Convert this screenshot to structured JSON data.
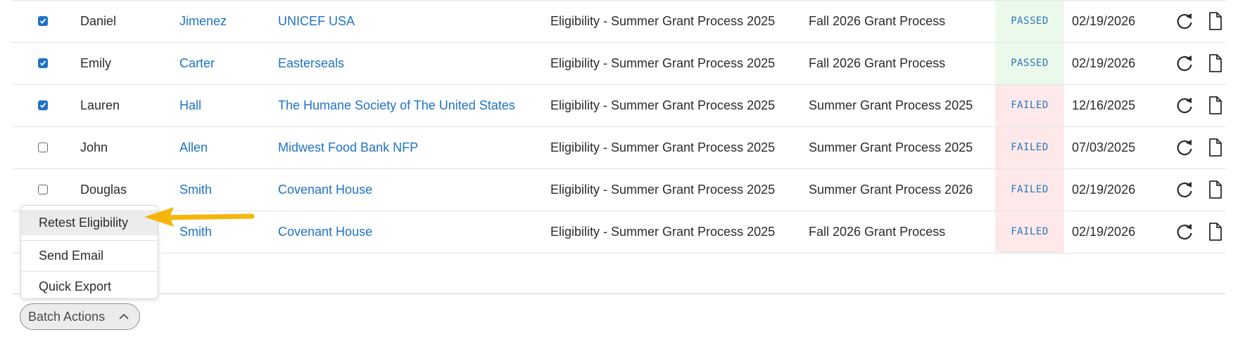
{
  "rows": [
    {
      "checked": true,
      "first": "Daniel",
      "last": "Jimenez",
      "org": "UNICEF USA",
      "eligibility": "Eligibility - Summer Grant Process 2025",
      "process": "Fall 2026 Grant Process",
      "status": "PASSED",
      "date": "02/19/2026"
    },
    {
      "checked": true,
      "first": "Emily",
      "last": "Carter",
      "org": "Easterseals",
      "eligibility": "Eligibility - Summer Grant Process 2025",
      "process": "Fall 2026 Grant Process",
      "status": "PASSED",
      "date": "02/19/2026"
    },
    {
      "checked": true,
      "first": "Lauren",
      "last": "Hall",
      "org": "The Humane Society of The United States",
      "eligibility": "Eligibility - Summer Grant Process 2025",
      "process": "Summer Grant Process 2025",
      "status": "FAILED",
      "date": "12/16/2025"
    },
    {
      "checked": false,
      "first": "John",
      "last": "Allen",
      "org": "Midwest Food Bank NFP",
      "eligibility": "Eligibility - Summer Grant Process 2025",
      "process": "Summer Grant Process 2025",
      "status": "FAILED",
      "date": "07/03/2025"
    },
    {
      "checked": false,
      "first": "Douglas",
      "last": "Smith",
      "org": "Covenant House",
      "eligibility": "Eligibility - Summer Grant Process 2025",
      "process": "Summer Grant Process 2026",
      "status": "FAILED",
      "date": "02/19/2026"
    },
    {
      "checked": false,
      "first": "",
      "last": "Smith",
      "org": "Covenant House",
      "eligibility": "Eligibility - Summer Grant Process 2025",
      "process": "Fall 2026 Grant Process",
      "status": "FAILED",
      "date": "02/19/2026"
    }
  ],
  "row_icons": {
    "retest": "refresh-icon",
    "document": "document-icon"
  },
  "menu": {
    "items": [
      {
        "label": "Retest Eligibility",
        "active": true
      },
      {
        "label": "Send Email",
        "active": false
      },
      {
        "label": "Quick Export",
        "active": false
      }
    ]
  },
  "batch_button": {
    "label": "Batch Actions",
    "icon": "chevron-up-icon"
  },
  "colors": {
    "link": "#1f73c4",
    "status_text": "#2f76b8",
    "passed_bg": "#eaf9ea",
    "failed_bg": "#fde9ea",
    "arrow": "#f5b50a"
  }
}
